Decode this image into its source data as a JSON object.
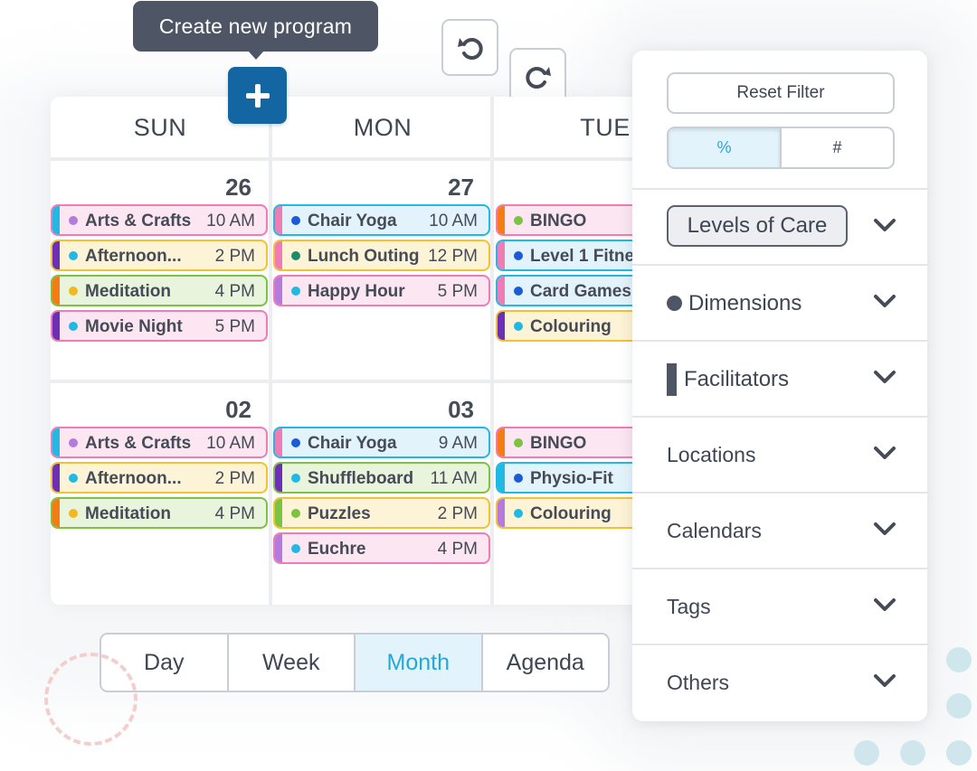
{
  "toolbar": {
    "tooltip": "Create new program",
    "create_icon": "plus-icon",
    "undo_icon": "undo-icon",
    "redo_icon": "redo-icon"
  },
  "calendar": {
    "columns": [
      "SUN",
      "MON",
      "TUE"
    ],
    "weeks": [
      {
        "days": [
          {
            "date": "26",
            "events": [
              {
                "name": "Arts & Crafts",
                "time": "10 AM",
                "bar": "#21b8e4",
                "dot": "#b57bdc",
                "bg": "#fbe6f2",
                "border": "#ee7db6"
              },
              {
                "name": "Afternoon...",
                "time": "2 PM",
                "bar": "#6d2fb3",
                "dot": "#21b8e4",
                "bg": "#fdf3d6",
                "border": "#f2c230"
              },
              {
                "name": "Meditation",
                "time": "4 PM",
                "bar": "#f57c14",
                "dot": "#f2b820",
                "bg": "#e8f4db",
                "border": "#7cc243"
              },
              {
                "name": "Movie Night",
                "time": "5 PM",
                "bar": "#6d2fb3",
                "dot": "#21b8e4",
                "bg": "#fbe6f2",
                "border": "#ee7db6"
              }
            ]
          },
          {
            "date": "27",
            "events": [
              {
                "name": "Chair Yoga",
                "time": "10 AM",
                "bar": "#ee7db6",
                "dot": "#1c5bd6",
                "bg": "#e3f3fb",
                "border": "#21b8e4"
              },
              {
                "name": "Lunch Outing",
                "time": "12 PM",
                "bar": "#ee7db6",
                "dot": "#1e8a6a",
                "bg": "#fdf3d6",
                "border": "#f2c230"
              },
              {
                "name": "Happy Hour",
                "time": "5 PM",
                "bar": "#b57bdc",
                "dot": "#21b8e4",
                "bg": "#fbe6f2",
                "border": "#ee7db6"
              }
            ]
          },
          {
            "date": "",
            "events": [
              {
                "name": "BINGO",
                "time": "",
                "bar": "#f57c14",
                "dot": "#7cc243",
                "bg": "#fbe6f2",
                "border": "#ee7db6"
              },
              {
                "name": "Level 1 Fitne",
                "time": "",
                "bar": "#ee7db6",
                "dot": "#1c5bd6",
                "bg": "#e3f3fb",
                "border": "#21b8e4"
              },
              {
                "name": "Card Games",
                "time": "",
                "bar": "#ee7db6",
                "dot": "#1c5bd6",
                "bg": "#e3f3fb",
                "border": "#21b8e4"
              },
              {
                "name": "Colouring",
                "time": "",
                "bar": "#6d2fb3",
                "dot": "#21b8e4",
                "bg": "#fdf3d6",
                "border": "#f2c230"
              }
            ]
          }
        ]
      },
      {
        "days": [
          {
            "date": "02",
            "events": [
              {
                "name": "Arts & Crafts",
                "time": "10 AM",
                "bar": "#21b8e4",
                "dot": "#b57bdc",
                "bg": "#fbe6f2",
                "border": "#ee7db6"
              },
              {
                "name": "Afternoon...",
                "time": "2 PM",
                "bar": "#6d2fb3",
                "dot": "#21b8e4",
                "bg": "#fdf3d6",
                "border": "#f2c230"
              },
              {
                "name": "Meditation",
                "time": "4 PM",
                "bar": "#f57c14",
                "dot": "#f2b820",
                "bg": "#e8f4db",
                "border": "#7cc243"
              }
            ]
          },
          {
            "date": "03",
            "events": [
              {
                "name": "Chair Yoga",
                "time": "9 AM",
                "bar": "#ee7db6",
                "dot": "#1c5bd6",
                "bg": "#e3f3fb",
                "border": "#21b8e4"
              },
              {
                "name": "Shuffleboard",
                "time": "11 AM",
                "bar": "#6d2fb3",
                "dot": "#21b8e4",
                "bg": "#e8f4db",
                "border": "#7cc243"
              },
              {
                "name": "Puzzles",
                "time": "2 PM",
                "bar": "#7cc243",
                "dot": "#7cc243",
                "bg": "#fdf3d6",
                "border": "#f2c230"
              },
              {
                "name": "Euchre",
                "time": "4 PM",
                "bar": "#b57bdc",
                "dot": "#21b8e4",
                "bg": "#fbe6f2",
                "border": "#ee7db6"
              }
            ]
          },
          {
            "date": "",
            "events": [
              {
                "name": "BINGO",
                "time": "",
                "bar": "#f57c14",
                "dot": "#7cc243",
                "bg": "#fbe6f2",
                "border": "#ee7db6"
              },
              {
                "name": "Physio-Fit",
                "time": "",
                "bar": "#21b8e4",
                "dot": "#1c5bd6",
                "bg": "#e3f3fb",
                "border": "#21b8e4"
              },
              {
                "name": "Colouring",
                "time": "",
                "bar": "#b57bdc",
                "dot": "#21b8e4",
                "bg": "#fdf3d6",
                "border": "#f2c230"
              }
            ]
          }
        ]
      }
    ]
  },
  "views": {
    "options": [
      "Day",
      "Week",
      "Month",
      "Agenda"
    ],
    "selected": "Month"
  },
  "filters": {
    "reset_label": "Reset Filter",
    "mode_options": [
      "%",
      "#"
    ],
    "mode_selected": "%",
    "sections": [
      "Levels of Care",
      "Dimensions",
      "Facilitators",
      "Locations",
      "Calendars",
      "Tags",
      "Others"
    ],
    "chevron_icon": "chevron-down-icon"
  },
  "colors": {
    "accent": "#1466a3",
    "active_bg": "#e3f3fb",
    "active_text": "#27a7d6",
    "tooltip_bg": "#4e5564"
  }
}
